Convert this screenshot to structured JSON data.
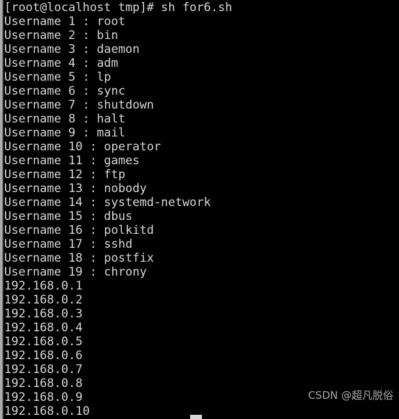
{
  "terminal": {
    "background_color": "#000000",
    "foreground_color": "#d6d6d6",
    "prompt_line": "[root@localhost tmp]# sh for6.sh",
    "lines": [
      "[root@localhost tmp]# sh for6.sh",
      "Username 1 : root",
      "Username 2 : bin",
      "Username 3 : daemon",
      "Username 4 : adm",
      "Username 5 : lp",
      "Username 6 : sync",
      "Username 7 : shutdown",
      "Username 8 : halt",
      "Username 9 : mail",
      "Username 10 : operator",
      "Username 11 : games",
      "Username 12 : ftp",
      "Username 13 : nobody",
      "Username 14 : systemd-network",
      "Username 15 : dbus",
      "Username 16 : polkitd",
      "Username 17 : sshd",
      "Username 18 : postfix",
      "Username 19 : chrony",
      "192.168.0.1",
      "192.168.0.2",
      "192.168.0.3",
      "192.168.0.4",
      "192.168.0.5",
      "192.168.0.6",
      "192.168.0.7",
      "192.168.0.8",
      "192.168.0.9",
      "192.168.0.10"
    ]
  },
  "watermark": {
    "text": "CSDN @超凡脱俗"
  }
}
